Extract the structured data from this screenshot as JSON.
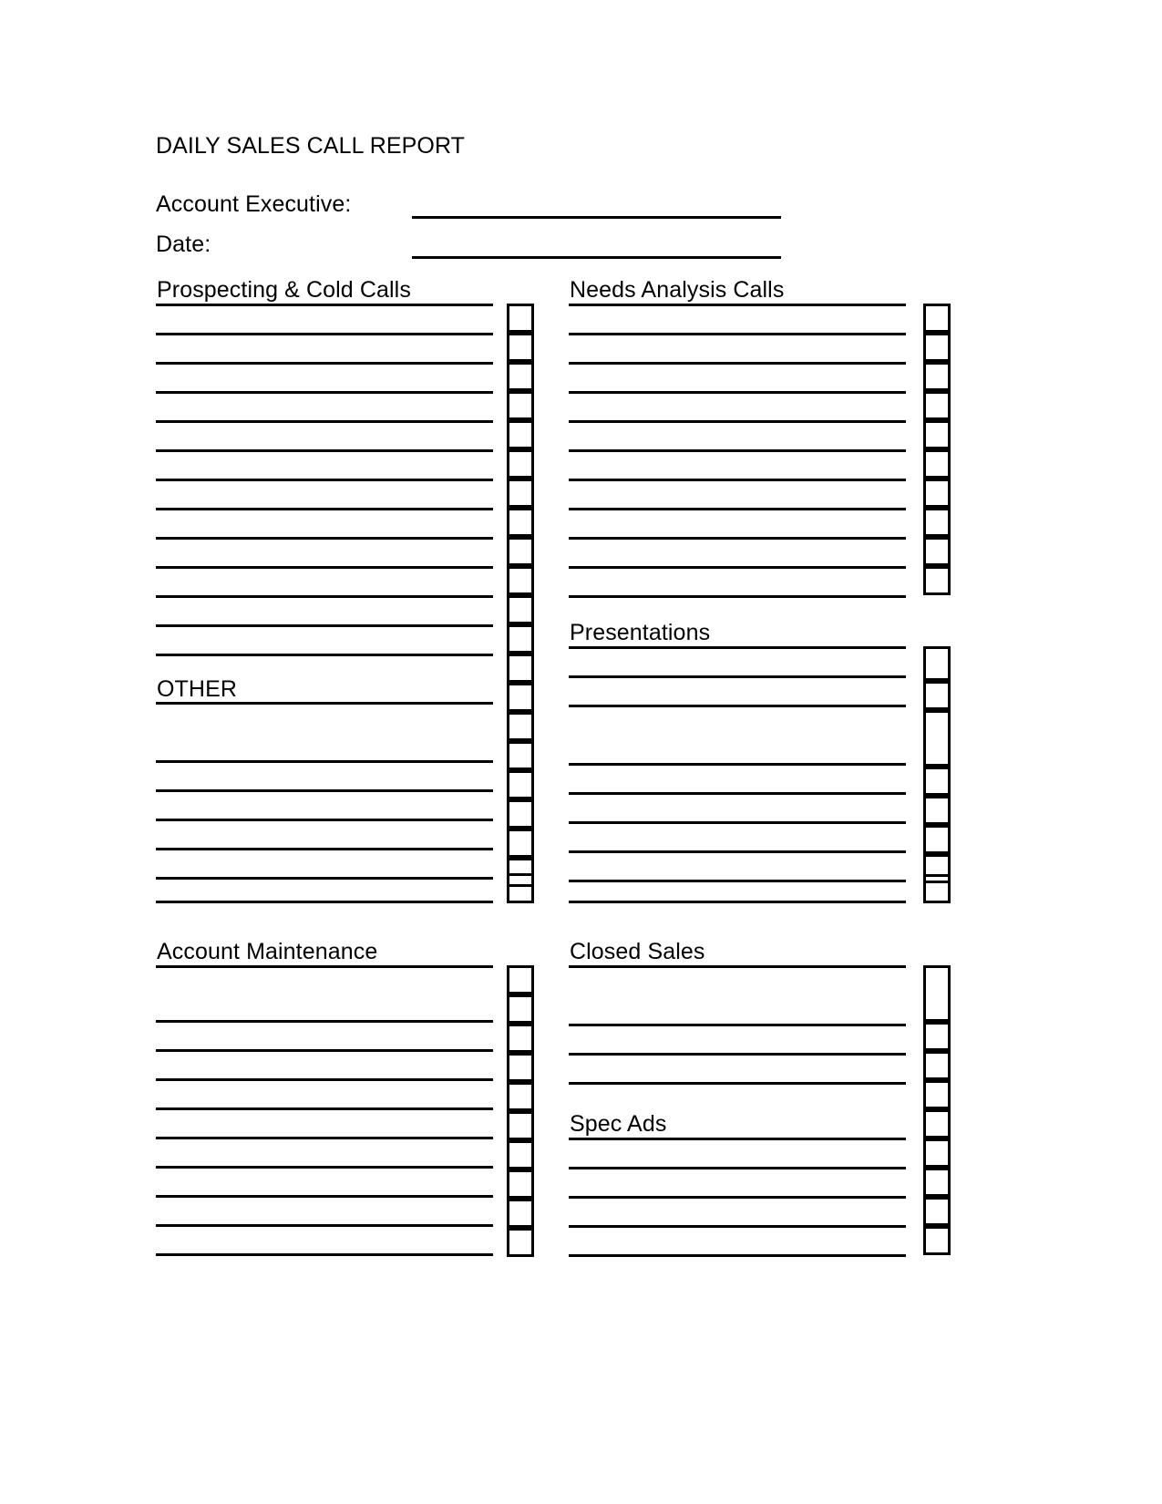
{
  "document": {
    "title": "DAILY SALES CALL REPORT",
    "fields": [
      {
        "label": "Account Executive:",
        "value": ""
      },
      {
        "label": "Date:",
        "value": ""
      }
    ],
    "sections": [
      {
        "id": "prospecting-cold-calls",
        "heading": "Prospecting & Cold Calls",
        "column": "left"
      },
      {
        "id": "other",
        "heading": "OTHER",
        "column": "left"
      },
      {
        "id": "account-maintenance",
        "heading": "Account Maintenance",
        "column": "left"
      },
      {
        "id": "needs-analysis-calls",
        "heading": "Needs Analysis Calls",
        "column": "right"
      },
      {
        "id": "presentations",
        "heading": "Presentations",
        "column": "right"
      },
      {
        "id": "closed-sales",
        "heading": "Closed Sales",
        "column": "right"
      },
      {
        "id": "spec-ads",
        "heading": "Spec Ads",
        "column": "right"
      }
    ],
    "colors": {
      "ink": "#000000",
      "paper": "#ffffff"
    }
  }
}
